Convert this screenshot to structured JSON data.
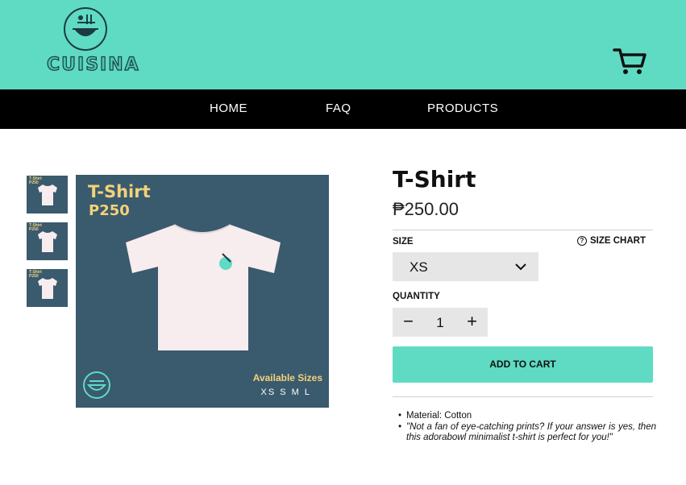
{
  "header": {
    "brand": "CUISINA",
    "logo_icon": "bowl-emblem-icon",
    "cart_icon": "cart-icon",
    "background": "#5fdbc3"
  },
  "nav": {
    "items": [
      {
        "label": "HOME"
      },
      {
        "label": "FAQ"
      },
      {
        "label": "PRODUCTS"
      }
    ]
  },
  "gallery": {
    "thumbs": [
      {
        "title": "T-Shirt",
        "price": "P250"
      },
      {
        "title": "T-Shirt",
        "price": "P250"
      },
      {
        "title": "T-Shirt",
        "price": "P250"
      }
    ],
    "image": {
      "title": "T-Shirt",
      "price": "P250",
      "available_label": "Available Sizes",
      "sizes": "XS S M L"
    }
  },
  "product": {
    "title": "T-Shirt",
    "price": "₱250.00",
    "size_label": "SIZE",
    "size_chart_label": "SIZE CHART",
    "selected_size": "XS",
    "quantity_label": "QUANTITY",
    "quantity": "1",
    "minus_label": "−",
    "plus_label": "+",
    "add_to_cart_label": "ADD TO CART",
    "accent_color": "#5fdbc3"
  },
  "description": {
    "material": "Material: Cotton",
    "quote": "\"Not a fan of eye-catching prints? If your answer is yes, then this adorabowl minimalist t-shirt is perfect for you!\""
  }
}
